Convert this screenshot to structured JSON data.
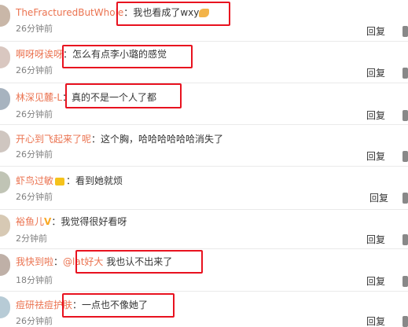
{
  "comments": [
    {
      "user": "TheFracturedButWhole",
      "text": "我也看成了wxy",
      "time": "26分钟前",
      "reply": "回复"
    },
    {
      "user": "啊呀呀诶呀",
      "text": "怎么有点李小璐的感觉",
      "time": "26分钟前",
      "reply": "回复"
    },
    {
      "user": "林深见麓-L",
      "text": "真的不是一个人了都",
      "time": "26分钟前",
      "reply": "回复"
    },
    {
      "user": "开心到飞起来了呢",
      "text": "这个胸，哈哈哈哈哈哈消失了",
      "time": "26分钟前",
      "reply": "回复"
    },
    {
      "user": "虾鸟过敏",
      "text": "看到她就烦",
      "time": "26分钟前",
      "reply": "回复"
    },
    {
      "user": "裕鱼儿",
      "text": "我觉得很好看呀",
      "time": "2分钟前",
      "reply": "回复"
    },
    {
      "user": "我快到啦",
      "mention": "@lat好大",
      "text": "我也认不出来了",
      "time": "18分钟前",
      "reply": "回复"
    },
    {
      "user": "痘研祛痘护肤",
      "text": "一点也不像她了",
      "time": "26分钟前",
      "reply": "回复"
    }
  ],
  "colon": "："
}
